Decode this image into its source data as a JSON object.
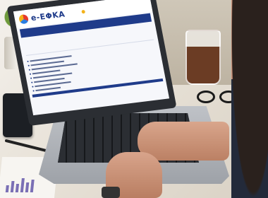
{
  "photo": {
    "website": {
      "logo_text": "e-ΕΦΚΑ",
      "brand_color": "#1f3b8a",
      "accent_color": "#f3b21a"
    }
  }
}
